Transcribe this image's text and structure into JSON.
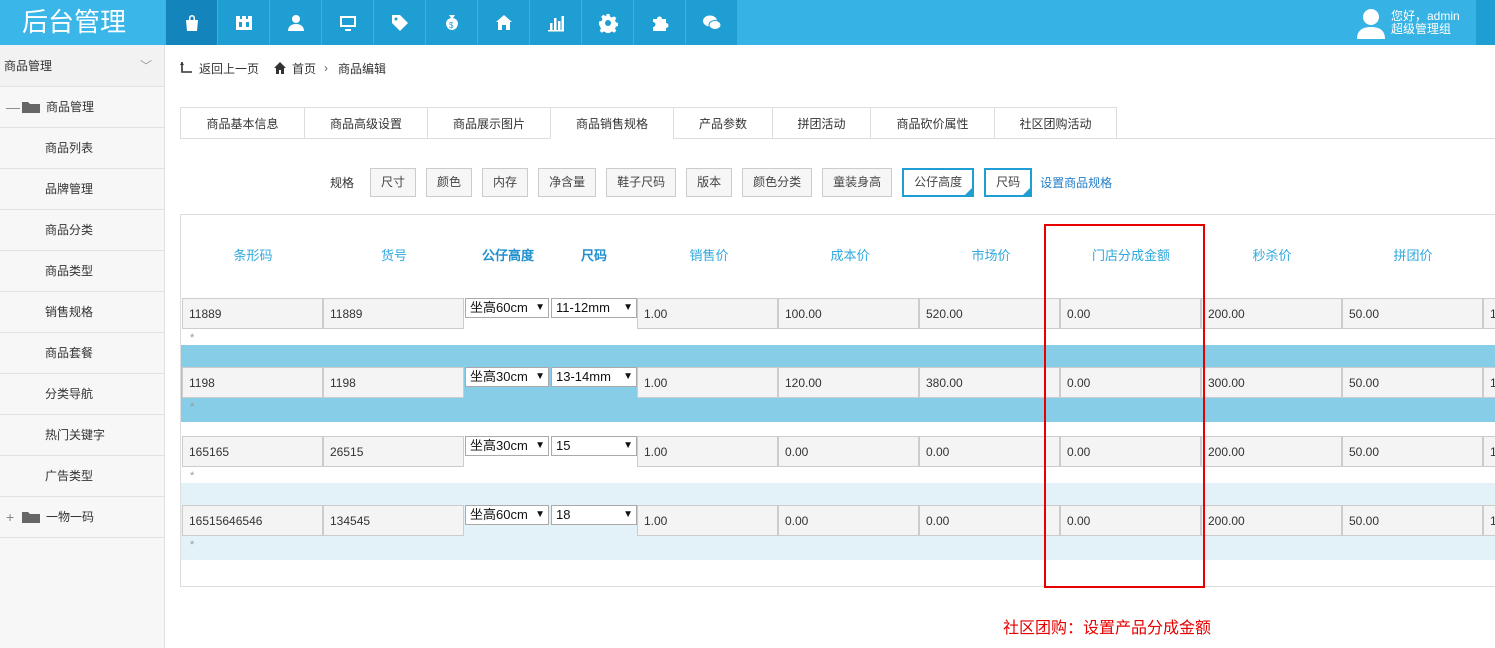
{
  "app": {
    "title": "后台管理"
  },
  "nav_icons": [
    "bag-icon",
    "grid-icon",
    "user-icon",
    "monitor-icon",
    "tag-icon",
    "moneybag-icon",
    "home-icon",
    "bar-chart-icon",
    "gear-icon",
    "puzzle-icon",
    "chat-icon"
  ],
  "user": {
    "greeting": "您好，admin",
    "role": "超级管理组"
  },
  "sidebar": {
    "header": "商品管理",
    "group1": {
      "toggle": "—",
      "label": "商品管理"
    },
    "items": [
      "商品列表",
      "品牌管理",
      "商品分类",
      "商品类型",
      "销售规格",
      "商品套餐",
      "分类导航",
      "热门关键字",
      "广告类型"
    ],
    "group2": {
      "toggle": "+",
      "label": "一物一码"
    }
  },
  "breadcrumb": {
    "back": "返回上一页",
    "home": "首页",
    "sep": "›",
    "current": "商品编辑"
  },
  "tabs": [
    "商品基本信息",
    "商品高级设置",
    "商品展示图片",
    "商品销售规格",
    "产品参数",
    "拼团活动",
    "商品砍价属性",
    "社区团购活动"
  ],
  "active_tab": 3,
  "specs": {
    "label": "规格",
    "buttons": [
      "尺寸",
      "颜色",
      "内存",
      "净含量",
      "鞋子尺码",
      "版本",
      "颜色分类",
      "童装身高"
    ],
    "selected": [
      "公仔高度",
      "尺码"
    ],
    "link": "设置商品规格"
  },
  "table": {
    "headers": [
      "条形码",
      "货号",
      "公仔高度",
      "尺码",
      "销售价",
      "成本价",
      "市场价",
      "门店分成金额",
      "秒杀价",
      "拼团价"
    ],
    "rows": [
      {
        "barcode": "11889",
        "sku": "11889",
        "height": "坐高60cm",
        "size": "11-12mm",
        "price": "1.00",
        "cost": "100.00",
        "market": "520.00",
        "share": "0.00",
        "seckill": "200.00",
        "group": "50.00",
        "extra": "1",
        "mark": "*"
      },
      {
        "barcode": "1198",
        "sku": "1198",
        "height": "坐高30cm",
        "size": "13-14mm",
        "price": "1.00",
        "cost": "120.00",
        "market": "380.00",
        "share": "0.00",
        "seckill": "300.00",
        "group": "50.00",
        "extra": "1",
        "mark": "*"
      },
      {
        "barcode": "165165",
        "sku": "26515",
        "height": "坐高30cm",
        "size": "15",
        "price": "1.00",
        "cost": "0.00",
        "market": "0.00",
        "share": "0.00",
        "seckill": "200.00",
        "group": "50.00",
        "extra": "1",
        "mark": "*"
      },
      {
        "barcode": "16515646546",
        "sku": "134545",
        "height": "坐高60cm",
        "size": "18",
        "price": "1.00",
        "cost": "0.00",
        "market": "0.00",
        "share": "0.00",
        "seckill": "200.00",
        "group": "50.00",
        "extra": "1",
        "mark": "*"
      }
    ]
  },
  "annotation": "社区团购：设置产品分成金额",
  "colors": {
    "header": "#36b3e4",
    "nav_icon_bg": "#1f9ed4",
    "highlight": "#87cde8",
    "annotation": "#e60000"
  }
}
